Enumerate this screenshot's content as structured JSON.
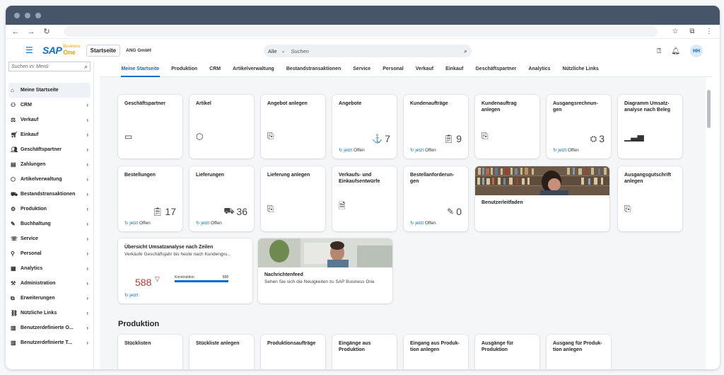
{
  "shell": {
    "home_label": "Startseite",
    "company": "ANG GmbH",
    "search_scope": "Alle",
    "search_placeholder": "Suchen",
    "user_initials": "HH",
    "logo_text": "SAP",
    "logo_sub1": "Business",
    "logo_sub2": "One"
  },
  "sidebar": {
    "search_placeholder": "Suchen in: Menü",
    "items": [
      {
        "label": "Meine Startseite",
        "icon": "home-icon"
      },
      {
        "label": "CRM",
        "icon": "crm-icon"
      },
      {
        "label": "Verkauf",
        "icon": "sales-icon"
      },
      {
        "label": "Einkauf",
        "icon": "cart-icon"
      },
      {
        "label": "Geschäftspartner",
        "icon": "partners-icon"
      },
      {
        "label": "Zahlungen",
        "icon": "payment-icon"
      },
      {
        "label": "Artikelverwaltung",
        "icon": "item-icon"
      },
      {
        "label": "Bestandstransaktionen",
        "icon": "inventory-icon"
      },
      {
        "label": "Produktion",
        "icon": "production-icon"
      },
      {
        "label": "Buchhaltung",
        "icon": "accounting-icon"
      },
      {
        "label": "Service",
        "icon": "service-icon"
      },
      {
        "label": "Personal",
        "icon": "person-icon"
      },
      {
        "label": "Analytics",
        "icon": "analytics-icon"
      },
      {
        "label": "Administration",
        "icon": "admin-icon"
      },
      {
        "label": "Erweiterungen",
        "icon": "extension-icon"
      },
      {
        "label": "Nützliche Links",
        "icon": "links-icon"
      },
      {
        "label": "Benutzerdefinierte O...",
        "icon": "custom-icon"
      },
      {
        "label": "Benutzerdefinierte T...",
        "icon": "custom-icon"
      }
    ]
  },
  "tabs": [
    "Meine Startseite",
    "Produktion",
    "CRM",
    "Artikelverwaltung",
    "Bestandstransaktionen",
    "Service",
    "Personal",
    "Verkauf",
    "Einkauf",
    "Geschäftspartner",
    "Analytics",
    "Nützliche Links"
  ],
  "tiles": {
    "t1": {
      "title": "Geschäftspartner"
    },
    "t2": {
      "title": "Artikel"
    },
    "t3": {
      "title": "Angebot anlegen"
    },
    "t4": {
      "title": "Angebote",
      "kpi": "7",
      "refresh": "jetzt",
      "status": "Offen"
    },
    "t5": {
      "title": "Kundenaufträge",
      "kpi": "9",
      "refresh": "jetzt",
      "status": "Offen"
    },
    "t6": {
      "title": "Kundenauftrag anlegen"
    },
    "t7": {
      "title": "Ausgangsrechnun-gen",
      "kpi": "3",
      "refresh": "jetzt",
      "status": "Offen"
    },
    "t8": {
      "title": "Diagramm Umsatz-analyse nach Beleg"
    },
    "t9": {
      "title": "Bestellungen",
      "kpi": "17",
      "refresh": "jetzt",
      "status": "Offen"
    },
    "t10": {
      "title": "Lieferungen",
      "kpi": "36",
      "refresh": "jetzt",
      "status": "Offen"
    },
    "t11": {
      "title": "Lieferung anlegen"
    },
    "t12": {
      "title": "Verkaufs- und Einkaufsentwürfe"
    },
    "t13": {
      "title": "Bestellanforderun-gen",
      "kpi": "0",
      "refresh": "jetzt",
      "status": "Offen"
    },
    "t14": {
      "title": "Benutzerleitfaden"
    },
    "t15": {
      "title": "Ausgangsgutschrift anlegen"
    },
    "t16": {
      "title": "Übersicht Umsatzanalyse nach Zeilen",
      "sub": "Verkäufe Geschäftsjahr bis heute nach Kundengru...",
      "kpi": "588",
      "bar_label": "Konstruktion",
      "bar_value": "588",
      "refresh": "jetzt"
    },
    "t17": {
      "title": "Nachrichtenfeed",
      "sub": "Sehen Sie sich die Neuigkeiten zu SAP Business One"
    }
  },
  "section2": {
    "title": "Produktion",
    "tiles": [
      "Stücklisten",
      "Stückliste anlegen",
      "Produktionsaufträge",
      "Eingänge aus Produktion",
      "Eingang aus Produk-tion anlegen",
      "Ausgänge für Produktion",
      "Ausgang für Produk-tion anlegen"
    ]
  },
  "colors": {
    "accent": "#0a6ed1",
    "negative": "#c83232",
    "titlebar": "#475569"
  }
}
